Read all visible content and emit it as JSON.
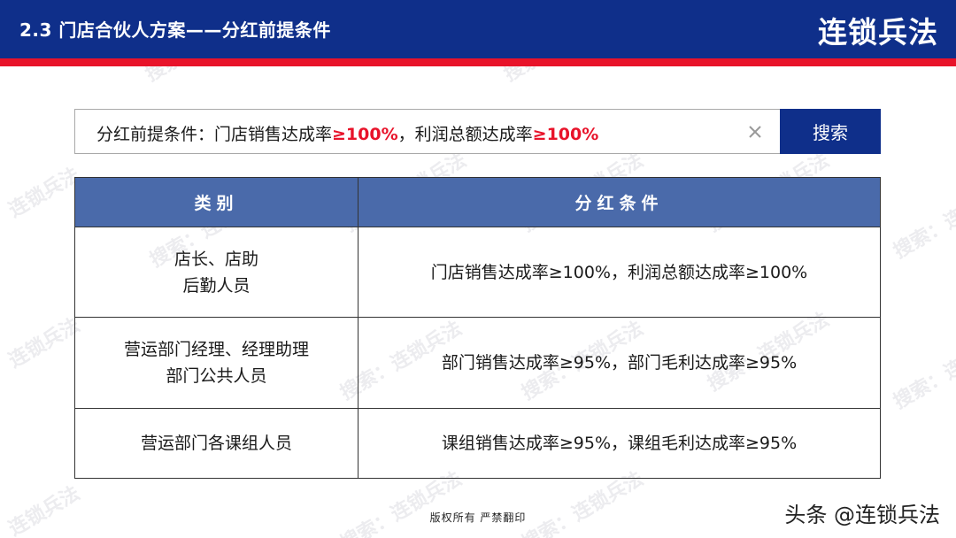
{
  "header": {
    "title": "2.3  门店合伙人方案——分红前提条件",
    "brand": "连锁兵法"
  },
  "search": {
    "prefix": "分红前提条件：门店销售达成率",
    "highlight1": "≥100%",
    "middle": "，利润总额达成率",
    "highlight2": "≥100%",
    "clear_icon": "close-icon",
    "button_label": "搜索"
  },
  "table": {
    "headers": [
      "类别",
      "分红条件"
    ],
    "rows": [
      {
        "category": [
          "店长、店助",
          "后勤人员"
        ],
        "condition": "门店销售达成率≥100%，利润总额达成率≥100%"
      },
      {
        "category": [
          "营运部门经理、经理助理",
          "部门公共人员"
        ],
        "condition": "部门销售达成率≥95%，部门毛利达成率≥95%"
      },
      {
        "category": [
          "营运部门各课组人员"
        ],
        "condition": "课组销售达成率≥95%，课组毛利达成率≥95%"
      }
    ]
  },
  "watermarks": [
    "连锁兵法",
    "搜索：连锁兵法"
  ],
  "footer": {
    "copyright": "版权所有  严禁翻印",
    "brand": "头条 @连锁兵法"
  },
  "colors": {
    "header_bg": "#0f2f8a",
    "stripe": "#e8132a",
    "table_header_bg": "#4a6aaa",
    "highlight": "#e8132a"
  }
}
